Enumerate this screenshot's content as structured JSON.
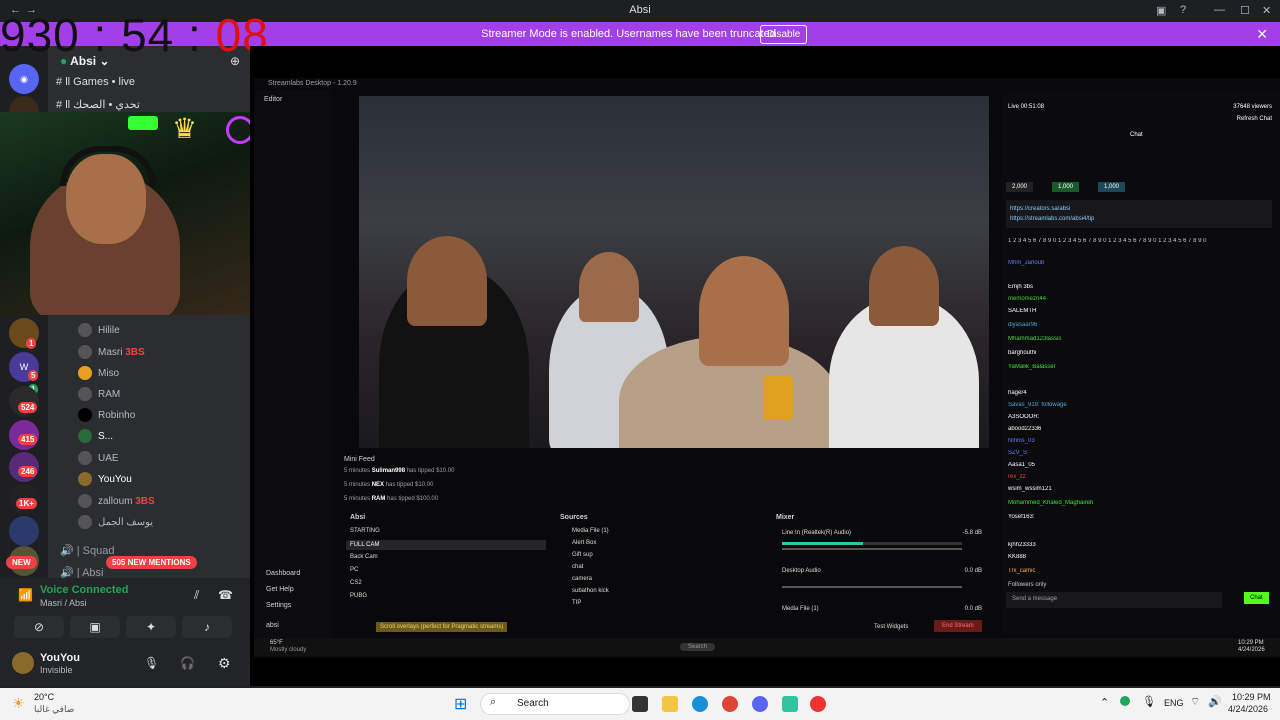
{
  "titlebar": {
    "title": "Absi"
  },
  "banner": {
    "message": "Streamer Mode is enabled. Usernames have been truncated.",
    "disable_label": "Disable"
  },
  "timer": {
    "h": "930",
    "m": "54",
    "s": "08",
    "sep": ":"
  },
  "server": {
    "name": "Absi"
  },
  "channels": [
    {
      "label": "ll Games • live"
    },
    {
      "label": "ll تحدي • الصحك"
    }
  ],
  "members": [
    {
      "name": "Hilile"
    },
    {
      "name": "Masri",
      "tag": "3BS"
    },
    {
      "name": "Miso"
    },
    {
      "name": "RAM"
    },
    {
      "name": "Robinho"
    },
    {
      "name": "S..."
    },
    {
      "name": "UAE"
    },
    {
      "name": "YouYou"
    },
    {
      "name": "zalloum",
      "tag": "3BS"
    },
    {
      "name": "يوسف الجمل"
    }
  ],
  "channels2": [
    {
      "label": "Squad"
    },
    {
      "label": "Absi"
    }
  ],
  "rail_badges": [
    "1",
    "5",
    "1",
    "524",
    "415",
    "246",
    "1K+"
  ],
  "mentions": {
    "label": "505 NEW MENTIONS",
    "new": "NEW"
  },
  "voice": {
    "status": "Voice Connected",
    "location": "Masri / Absi"
  },
  "user": {
    "name": "YouYou",
    "status": "Invisible"
  },
  "streamlabs": {
    "title": "Streamlabs Desktop - 1.20.9",
    "editor": "Editor",
    "minifeed": "Mini Feed",
    "feed": [
      {
        "time": "5 minutes",
        "user": "Suliman998",
        "text": "has tipped $10.00"
      },
      {
        "time": "5 minutes",
        "user": "NEX",
        "text": "has tipped $10.00"
      },
      {
        "time": "5 minutes",
        "user": "RAM",
        "text": "has tipped $100.00"
      }
    ],
    "scenes_title": "Absi",
    "scenes": [
      "STARTING",
      "FULL CAM",
      "Back Cam",
      "PC",
      "CS2",
      "PUBG"
    ],
    "sources_title": "Sources",
    "sources": [
      "Media File (1)",
      "Alert Box",
      "Gift sup",
      "chat",
      "camera",
      "subathon kick",
      "TIP"
    ],
    "mixer_title": "Mixer",
    "mixer": [
      {
        "name": "Line In (Realtek(R) Audio)",
        "db": "-5.8 dB"
      },
      {
        "name": "Desktop Audio",
        "db": "0.0 dB"
      },
      {
        "name": "Media File (1)",
        "db": "0.0 dB"
      }
    ],
    "nav": [
      "Dashboard",
      "Get Help",
      "Settings",
      "absi"
    ],
    "test_widgets": "Test Widgets",
    "end_stream": "End Stream",
    "notice": "Scroll overlays (perfect for Pragmatic streams)",
    "live_time": "Live 00:51:08",
    "viewers": "37648 viewers",
    "refresh": "Refresh Chat",
    "chat_title": "Chat",
    "chat_input": "Send a message",
    "chat_btn": "Chat",
    "followers": "Followers only",
    "gifts": [
      "2,000",
      "1,000",
      "1,000"
    ],
    "chat_lines": [
      "https://creators.sa/absi",
      "https://streamlabs.com/absi4/tip",
      "1 2 3 4 5 6 7 8 9 0 1 2 3 4 5 6 7 8 9 0 1 2 3 4 5 6 7 8 9 0 1 2 3 4 5 6 7 8 9 0",
      "Mhm_Janoub",
      "Emjh 3bs",
      "memomezn44",
      "SALEMTH",
      "diyasaar96",
      "Mhammad123lassis",
      "barghouthi",
      "YaMalik_Balasser",
      "hager4",
      "Savas_919: followage",
      "A3SOOOR:",
      "abood22336",
      "Ninnis_03",
      "SZV_S",
      "Aasa1_05",
      "rex_zz",
      "wsim_wssim121",
      "Mohammed_Khaled_Maghaireh",
      "Yosef163:",
      "kjhh23333",
      "KK888",
      "Trx_camic"
    ],
    "weather": {
      "temp": "65°F",
      "cond": "Mostly cloudy"
    },
    "clock": {
      "time": "10:29 PM",
      "date": "4/24/2026"
    }
  },
  "taskbar": {
    "search": "Search",
    "temp": "20°C",
    "weather": "صافي غالبا",
    "lang": "ENG",
    "time": "10:29 PM",
    "date": "4/24/2026"
  }
}
